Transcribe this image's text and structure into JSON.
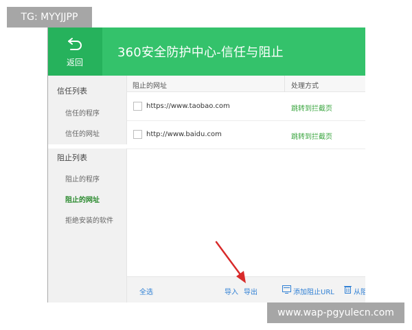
{
  "header": {
    "back_label": "返回",
    "title": "360安全防护中心-信任与阻止"
  },
  "sidebar": {
    "trust_section": "信任列表",
    "trust_items": [
      "信任的程序",
      "信任的网址"
    ],
    "block_section": "阻止列表",
    "block_items": [
      "阻止的程序",
      "阻止的网址",
      "拒绝安装的软件"
    ],
    "active_item": "阻止的网址"
  },
  "table": {
    "columns": [
      "阻止的网址",
      "处理方式"
    ],
    "rows": [
      {
        "url": "https://www.taobao.com",
        "action": "跳转到拦截页",
        "checked": false
      },
      {
        "url": "http://www.baidu.com",
        "action": "跳转到拦截页",
        "checked": false
      }
    ]
  },
  "footer": {
    "select_all": "全选",
    "import": "导入",
    "export": "导出",
    "add_url": "添加阻止URL",
    "remove": "从阻"
  },
  "watermarks": {
    "top_left": "TG: MYYJJPP",
    "bottom_right": "www.wap-pgyulecn.com"
  },
  "colors": {
    "header_green": "#34c26b",
    "back_green": "#26b25c",
    "action_green": "#3aa53f",
    "link_blue": "#2e7fd4",
    "arrow_red": "#d82a2a"
  },
  "icons": {
    "back": "back-arrow-icon",
    "add": "add-url-icon",
    "remove": "trash-icon"
  }
}
